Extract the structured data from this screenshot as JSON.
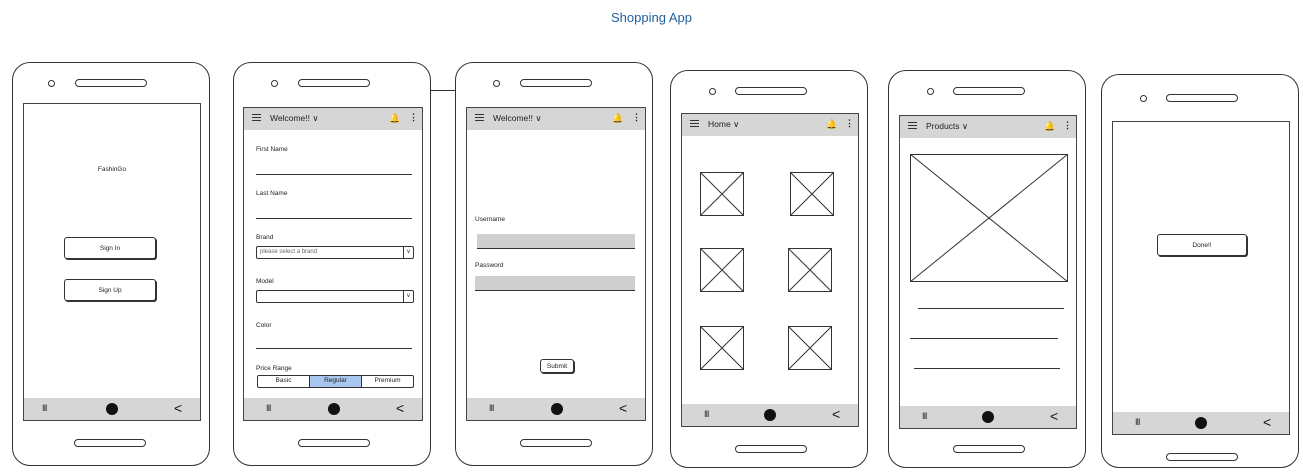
{
  "page_title": "Shopping App",
  "icons": {
    "menu": "hamburger-icon",
    "dropdown": "chevron-down-icon",
    "bell": "bell-icon",
    "more": "kebab-icon",
    "recents": "recents-icon",
    "home": "home-dot-icon",
    "back": "back-chevron-icon",
    "image": "image-placeholder-icon"
  },
  "glyphs": {
    "chevron": "∨",
    "bell": "🔔",
    "kebab": "⋮",
    "recents": "III",
    "back": "<"
  },
  "colors": {
    "title": "#1f5f9e",
    "bar": "#d6d6d6",
    "selected_segment": "#a9c6ef",
    "gray_field": "#cfcfcf"
  },
  "screen1": {
    "app_name": "FashinGo",
    "signin_label": "Sign In",
    "signup_label": "Sign Up"
  },
  "screen2": {
    "topbar_title": "Welcome!!",
    "first_name_label": "First Name",
    "last_name_label": "Last Name",
    "brand_label": "Brand",
    "brand_placeholder": "please select a brand",
    "model_label": "Model",
    "color_label": "Color",
    "price_range_label": "Price Range",
    "price_options": [
      "Basic",
      "Regular",
      "Premium"
    ],
    "price_selected": "Regular"
  },
  "screen3": {
    "topbar_title": "Welcome!!",
    "username_label": "Username",
    "password_label": "Password",
    "submit_label": "Submit"
  },
  "screen4": {
    "topbar_title": "Home"
  },
  "screen5": {
    "topbar_title": "Products"
  },
  "screen6": {
    "done_label": "Done!!"
  }
}
